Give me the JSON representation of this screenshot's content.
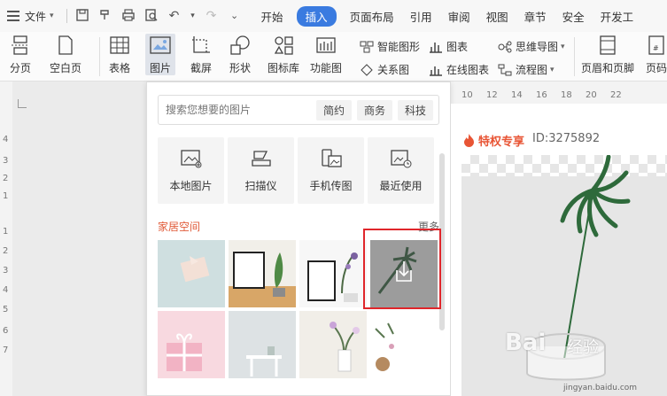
{
  "menubar": {
    "file_label": "文件",
    "tabs": [
      "开始",
      "插入",
      "页面布局",
      "引用",
      "审阅",
      "视图",
      "章节",
      "安全",
      "开发工"
    ],
    "active_tab": "插入"
  },
  "ribbon": {
    "page_break": "分页",
    "blank_page": "空白页",
    "table": "表格",
    "picture": "图片",
    "screenshot": "截屏",
    "shape": "形状",
    "icon_lib": "图标库",
    "function_chart": "功能图",
    "smart_art": "智能图形",
    "chart": "图表",
    "mind_map": "思维导图",
    "relation": "关系图",
    "online_chart": "在线图表",
    "flow_chart": "流程图",
    "header_footer": "页眉和页脚",
    "page_num": "页码"
  },
  "ruler": {
    "top": [
      "10",
      "12",
      "14",
      "16",
      "18",
      "20",
      "22"
    ],
    "left": [
      "4",
      "3",
      "2",
      "1",
      "",
      "1",
      "2",
      "3",
      "4",
      "5",
      "6",
      "7"
    ]
  },
  "panel": {
    "search_placeholder": "搜索您想要的图片",
    "chips": [
      "简约",
      "商务",
      "科技"
    ],
    "sources": [
      "本地图片",
      "扫描仪",
      "手机传图",
      "最近使用"
    ],
    "section_title": "家居空间",
    "more": "更多"
  },
  "preview": {
    "badge": "特权专享",
    "id_text": "ID:3275892"
  },
  "watermark": {
    "brand": "Bai",
    "brand2": "经验",
    "url": "jingyan.baidu.com"
  }
}
